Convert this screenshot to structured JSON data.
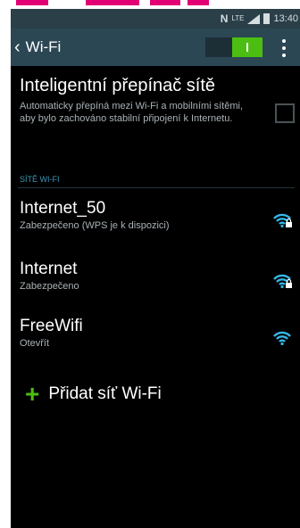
{
  "status_bar": {
    "nfc": "N",
    "network_type": "LTE",
    "time": "13:40"
  },
  "action_bar": {
    "title": "Wi-Fi",
    "wifi_enabled": true,
    "accent": "#4cbe13"
  },
  "smart_switch": {
    "title": "Inteligentní přepínač sítě",
    "description": "Automaticky přepíná mezi Wi-Fi a mobilními sítěmi, aby bylo zachováno stabilní připojení k Internetu.",
    "checked": false
  },
  "networks_section": {
    "header": "SÍTĚ WI-FI",
    "items": [
      {
        "name": "Internet_50",
        "status": "Zabezpečeno (WPS je k dispozici)",
        "icon": "wifi-locked-icon"
      },
      {
        "name": "Internet",
        "status": "Zabezpečeno",
        "icon": "wifi-locked-icon"
      },
      {
        "name": "FreeWifi",
        "status": "Otevřít",
        "icon": "wifi-icon"
      }
    ]
  },
  "add_network": {
    "label": "Přidat síť Wi-Fi",
    "icon": "plus-icon"
  }
}
